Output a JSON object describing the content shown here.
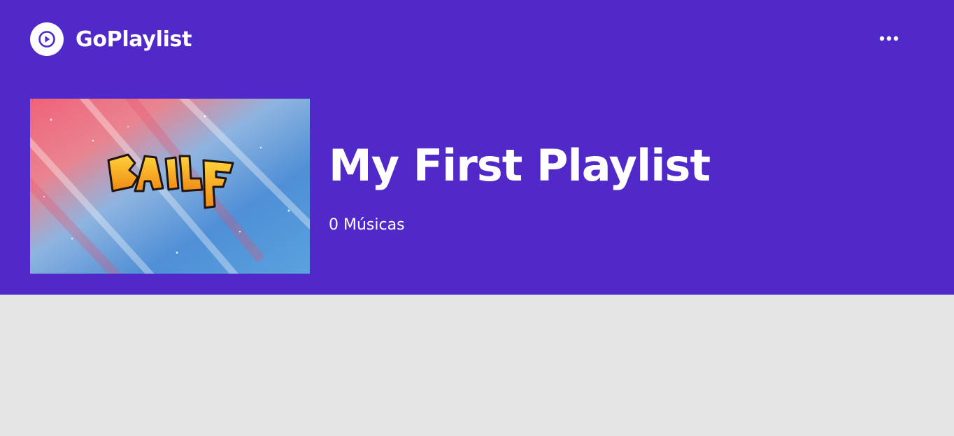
{
  "colors": {
    "hero_background": "#5229c9",
    "page_background": "#e5e5e5",
    "text": "#ffffff"
  },
  "header": {
    "brand_name": "GoPlaylist",
    "logo_icon": "play-circle-icon",
    "menu_icon": "more-horizontal-icon"
  },
  "playlist": {
    "title": "My First Playlist",
    "count_label": "0 Músicas",
    "cover_text": "BAILE"
  }
}
